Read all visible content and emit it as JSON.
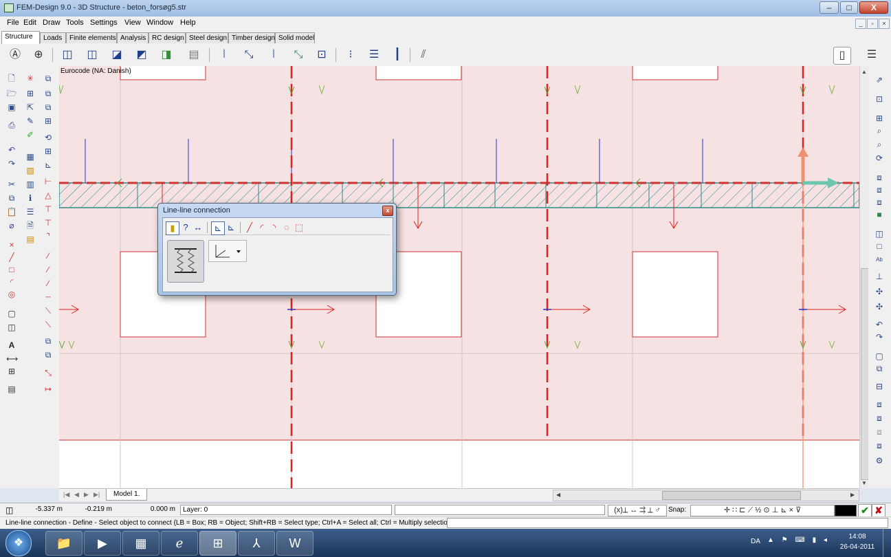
{
  "window": {
    "title": "FEM-Design 9.0 - 3D Structure - beton_forsøg5.str",
    "min_label": "–",
    "max_label": "□",
    "close_label": "X"
  },
  "menubar": {
    "items": [
      "File",
      "Edit",
      "Draw",
      "Tools",
      "Settings",
      "View",
      "Window",
      "Help"
    ]
  },
  "tabs": [
    "Structure",
    "Loads",
    "Finite elements",
    "Analysis",
    "RC design",
    "Steel design",
    "Timber design",
    "Solid model"
  ],
  "canvas": {
    "code_label": "Eurocode (NA: Danish)"
  },
  "dialog": {
    "title": "Line-line connection",
    "close_label": "x"
  },
  "model_tabs": {
    "nav": [
      "|◀",
      "◀",
      "▶",
      "▶|"
    ],
    "active": "Model 1."
  },
  "status": {
    "x": "-5.337 m",
    "y": "-0.219 m",
    "z": "0.000 m",
    "layer": "Layer: 0",
    "snap_label": "Snap:",
    "prompt": "Line-line connection - Define - Select object to connect (LB = Box; RB = Object; Shift+RB = Select type; Ctrl+A = Select all; Ctrl = Multiply selection) :"
  },
  "taskbar": {
    "language": "DA",
    "time": "14:08",
    "date": "26-04-2011"
  },
  "colors": {
    "slab_fill": "#f6e2e2",
    "slab_edge": "#cc3333",
    "beam_hatch": "#2a8a8a",
    "load_red": "#dd2222",
    "load_blue": "#2233cc"
  }
}
